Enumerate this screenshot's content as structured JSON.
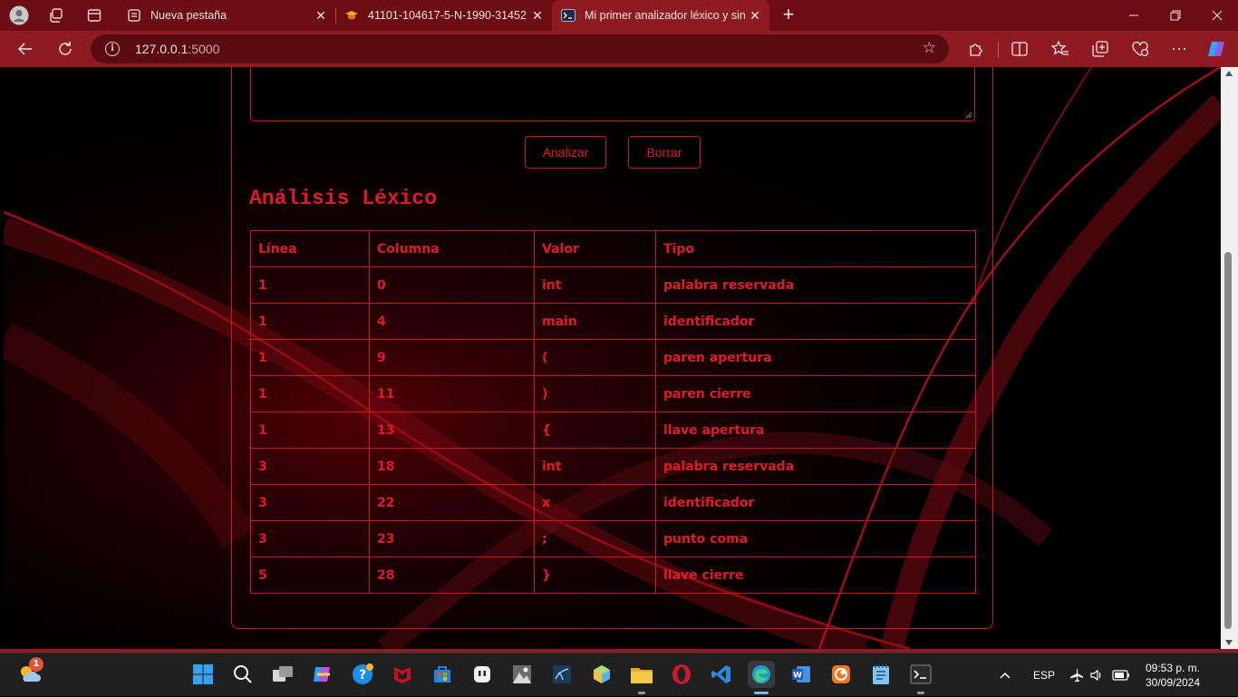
{
  "browser": {
    "tabs": [
      {
        "title": "Nueva pestaña",
        "icon": "page-icon"
      },
      {
        "title": "41101-104617-5-N-1990-31452",
        "icon": "reader-icon"
      },
      {
        "title": "Mi primer analizador léxico y sint",
        "icon": "terminal-icon"
      }
    ],
    "address": {
      "host": "127.0.0.1",
      "port": ":5000"
    },
    "colors": {
      "frame": "#6e0c14",
      "toolbar": "#8e1a22",
      "accent": "#e01b28"
    }
  },
  "page": {
    "buttons": {
      "analyze": "Analizar",
      "clear": "Borrar"
    },
    "heading": "Análisis Léxico",
    "table": {
      "columns": [
        "Línea",
        "Columna",
        "Valor",
        "Tipo"
      ],
      "rows": [
        [
          "1",
          "0",
          "int",
          "palabra reservada"
        ],
        [
          "1",
          "4",
          "main",
          "identificador"
        ],
        [
          "1",
          "9",
          "(",
          "paren apertura"
        ],
        [
          "1",
          "11",
          ")",
          "paren cierre"
        ],
        [
          "1",
          "13",
          "{",
          "llave apertura"
        ],
        [
          "3",
          "18",
          "int",
          "palabra reservada"
        ],
        [
          "3",
          "22",
          "x",
          "identificador"
        ],
        [
          "3",
          "23",
          ";",
          "punto coma"
        ],
        [
          "5",
          "28",
          "}",
          "llave cierre"
        ]
      ]
    }
  },
  "taskbar": {
    "weather_badge": "1",
    "language": "ESP",
    "time": "09:53 p. m.",
    "date": "30/09/2024"
  }
}
